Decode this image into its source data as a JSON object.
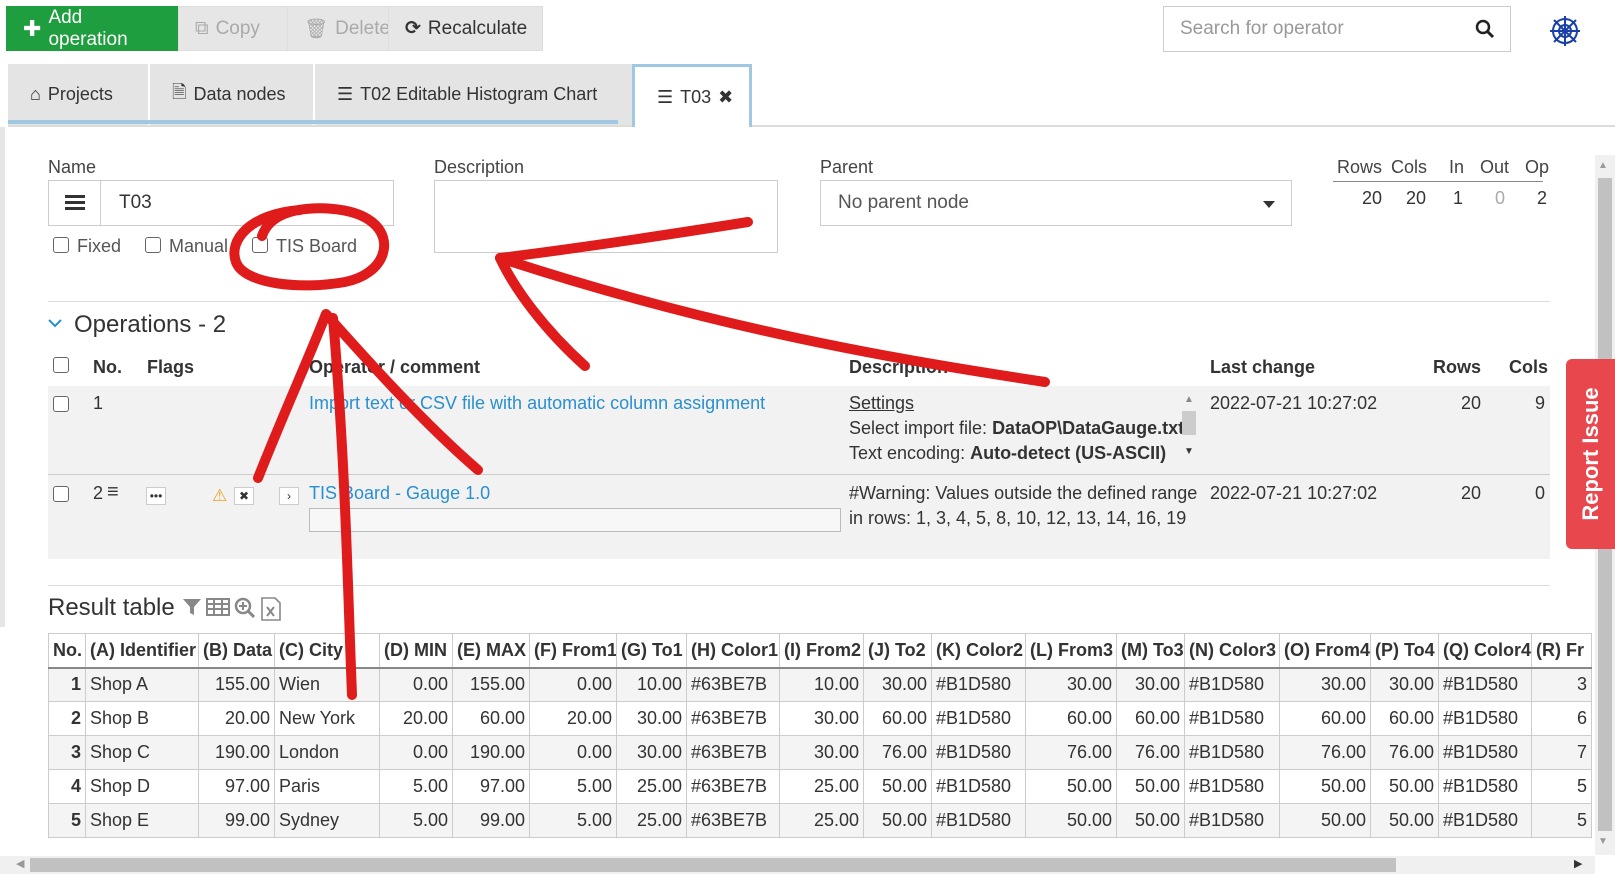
{
  "toolbar": {
    "add_label": "Add operation",
    "copy_label": "Copy",
    "delete_label": "Delete",
    "recalc_label": "Recalculate",
    "search_placeholder": "Search for operator"
  },
  "tabs": [
    {
      "label": "Projects",
      "icon": "home-icon"
    },
    {
      "label": "Data nodes",
      "icon": "file-icon"
    },
    {
      "label": "T02 Editable Histogram Chart",
      "icon": "table-icon"
    },
    {
      "label": "T03",
      "icon": "table-icon",
      "active": true
    }
  ],
  "form": {
    "name_label": "Name",
    "name_value": "T03",
    "fixed_label": "Fixed",
    "manual_label": "Manual",
    "tis_label": "TIS Board",
    "description_label": "Description",
    "description_value": "",
    "parent_label": "Parent",
    "parent_value": "No parent node"
  },
  "stats": {
    "headers": [
      "Rows",
      "Cols",
      "In",
      "Out",
      "Op"
    ],
    "values": [
      "20",
      "20",
      "1",
      "0",
      "2"
    ]
  },
  "operations": {
    "title": "Operations - 2",
    "headers": {
      "no": "No.",
      "flags": "Flags",
      "operator": "Operator / comment",
      "description": "Description",
      "last_change": "Last change",
      "rows": "Rows",
      "cols": "Cols"
    },
    "rows": [
      {
        "no": "1",
        "operator": "Import text or CSV file with automatic column assignment",
        "desc_link": "Settings",
        "desc_line1_label": "Select import file: ",
        "desc_line1_value": "DataOP\\DataGauge.txt",
        "desc_line2_label": "Text encoding: ",
        "desc_line2_value": "Auto-detect (US-ASCII)",
        "last_change": "2022-07-21 10:27:02",
        "rows": "20",
        "cols": "9"
      },
      {
        "no": "2",
        "operator": "TIS Board - Gauge 1.0",
        "desc_line1": "#Warning: Values outside the defined range",
        "desc_line2": "in rows: 1, 3, 4, 5, 8, 10, 12, 13, 14, 16, 19",
        "last_change": "2022-07-21 10:27:02",
        "rows": "20",
        "cols": "0"
      }
    ]
  },
  "result_table": {
    "title": "Result table",
    "columns": [
      "No.",
      "(A) Identifier",
      "(B) Data",
      "(C) City",
      "(D) MIN",
      "(E) MAX",
      "(F) From1",
      "(G) To1",
      "(H) Color1",
      "(I) From2",
      "(J) To2",
      "(K) Color2",
      "(L) From3",
      "(M) To3",
      "(N) Color3",
      "(O) From4",
      "(P) To4",
      "(Q) Color4",
      "(R) Fr"
    ],
    "rows": [
      [
        "1",
        "Shop A",
        "155.00",
        "Wien",
        "0.00",
        "155.00",
        "0.00",
        "10.00",
        "#63BE7B",
        "10.00",
        "30.00",
        "#B1D580",
        "30.00",
        "30.00",
        "#B1D580",
        "30.00",
        "30.00",
        "#B1D580",
        "3"
      ],
      [
        "2",
        "Shop B",
        "20.00",
        "New York",
        "20.00",
        "60.00",
        "20.00",
        "30.00",
        "#63BE7B",
        "30.00",
        "60.00",
        "#B1D580",
        "60.00",
        "60.00",
        "#B1D580",
        "60.00",
        "60.00",
        "#B1D580",
        "6"
      ],
      [
        "3",
        "Shop C",
        "190.00",
        "London",
        "0.00",
        "190.00",
        "0.00",
        "30.00",
        "#63BE7B",
        "30.00",
        "76.00",
        "#B1D580",
        "76.00",
        "76.00",
        "#B1D580",
        "76.00",
        "76.00",
        "#B1D580",
        "7"
      ],
      [
        "4",
        "Shop D",
        "97.00",
        "Paris",
        "5.00",
        "97.00",
        "5.00",
        "25.00",
        "#63BE7B",
        "25.00",
        "50.00",
        "#B1D580",
        "50.00",
        "50.00",
        "#B1D580",
        "50.00",
        "50.00",
        "#B1D580",
        "5"
      ],
      [
        "5",
        "Shop E",
        "99.00",
        "Sydney",
        "5.00",
        "99.00",
        "5.00",
        "25.00",
        "#63BE7B",
        "25.00",
        "50.00",
        "#B1D580",
        "50.00",
        "50.00",
        "#B1D580",
        "50.00",
        "50.00",
        "#B1D580",
        "5"
      ]
    ]
  },
  "report_issue": "Report Issue",
  "colors": {
    "accent": "#1e9e3e",
    "link": "#2a8fd0",
    "annotation": "#e01b1b",
    "report": "#e8484d"
  }
}
